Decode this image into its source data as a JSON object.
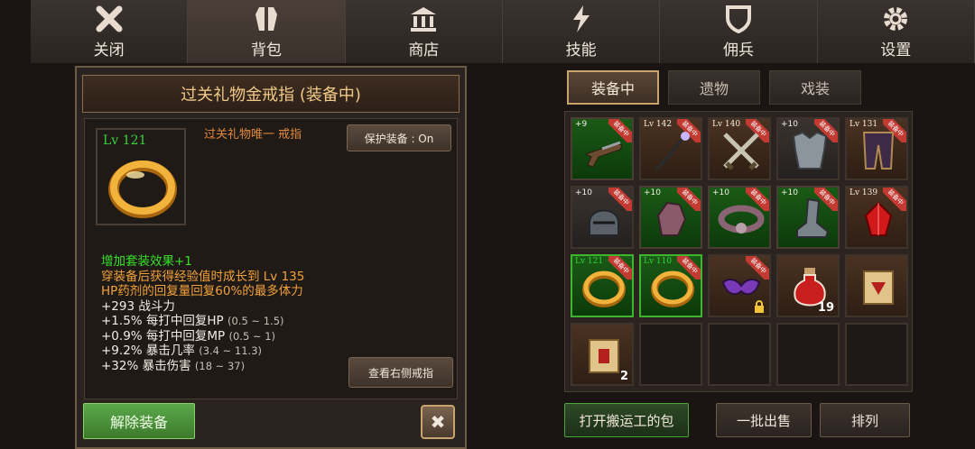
{
  "nav": [
    {
      "label": "关闭",
      "icon": "close-icon"
    },
    {
      "label": "背包",
      "icon": "armor-icon"
    },
    {
      "label": "商店",
      "icon": "shop-icon"
    },
    {
      "label": "技能",
      "icon": "lightning-icon"
    },
    {
      "label": "佣兵",
      "icon": "shield-icon"
    },
    {
      "label": "设置",
      "icon": "gear-icon"
    }
  ],
  "detail": {
    "title": "过关礼物金戒指 (装备中)",
    "level": "Lv 121",
    "subtitle": "过关礼物唯一 戒指",
    "protect_label": "保护装备 : On",
    "stats": {
      "set_bonus": "增加套装效果+1",
      "line1": "穿装备后获得经验值时成长到 Lv 135",
      "line2": "HP药剂的回复量回复60%的最多体力",
      "power": "+293 战斗力",
      "s1": "+1.5% 每打中回复HP",
      "s1_range": "(0.5 ~ 1.5)",
      "s2": "+0.9% 每打中回复MP",
      "s2_range": "(0.5 ~ 1)",
      "s3": "+9.2% 暴击几率",
      "s3_range": "(3.4 ~ 11.3)",
      "s4": "+32% 暴击伤害",
      "s4_range": "(18 ~ 37)"
    },
    "view_right_label": "查看右侧戒指",
    "unequip_label": "解除装备",
    "close_label": "✖"
  },
  "tabs": [
    "装备中",
    "遗物",
    "戏装"
  ],
  "equipped_badge": "装备中",
  "slots": [
    {
      "tag": "+9",
      "equipped": true,
      "icon": "gun-icon"
    },
    {
      "tag": "Lv 142",
      "equipped": true,
      "icon": "staff-icon"
    },
    {
      "tag": "Lv 140",
      "equipped": true,
      "icon": "crossed-swords-icon"
    },
    {
      "tag": "+10",
      "equipped": true,
      "icon": "chest-armor-icon"
    },
    {
      "tag": "Lv 131",
      "equipped": true,
      "icon": "leg-armor-icon"
    },
    {
      "tag": "+10",
      "equipped": true,
      "icon": "helmet-icon"
    },
    {
      "tag": "+10",
      "equipped": true,
      "icon": "gauntlet-icon"
    },
    {
      "tag": "+10",
      "equipped": true,
      "icon": "belt-icon"
    },
    {
      "tag": "+10",
      "equipped": true,
      "icon": "boots-icon"
    },
    {
      "tag": "Lv 139",
      "equipped": true,
      "icon": "red-gem-icon"
    },
    {
      "tag": "Lv 121",
      "equipped": true,
      "icon": "gold-ring-icon"
    },
    {
      "tag": "Lv 110",
      "equipped": true,
      "icon": "gold-ring-icon"
    },
    {
      "tag": "",
      "equipped": true,
      "icon": "mask-icon"
    },
    {
      "tag": "",
      "equipped": false,
      "icon": "potion-icon",
      "count": "19"
    },
    {
      "tag": "",
      "equipped": false,
      "icon": "scroll-icon"
    },
    {
      "tag": "",
      "equipped": false,
      "icon": "scroll-icon",
      "count": "2"
    }
  ],
  "bottom": {
    "open_bag": "打开搬运工的包",
    "bulk_sell": "一批出售",
    "sort": "排列"
  }
}
